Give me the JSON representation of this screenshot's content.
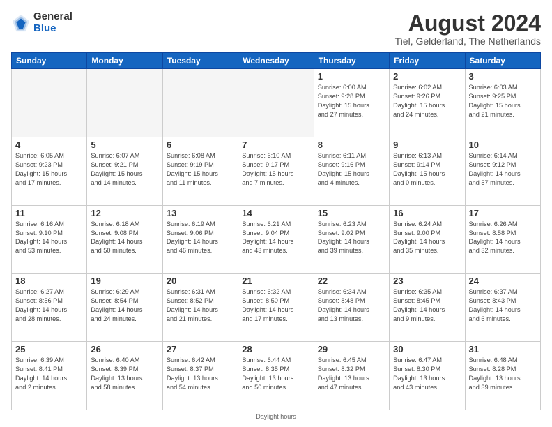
{
  "header": {
    "logo_general": "General",
    "logo_blue": "Blue",
    "main_title": "August 2024",
    "subtitle": "Tiel, Gelderland, The Netherlands"
  },
  "days_of_week": [
    "Sunday",
    "Monday",
    "Tuesday",
    "Wednesday",
    "Thursday",
    "Friday",
    "Saturday"
  ],
  "weeks": [
    [
      {
        "day": "",
        "info": "",
        "empty": true
      },
      {
        "day": "",
        "info": "",
        "empty": true
      },
      {
        "day": "",
        "info": "",
        "empty": true
      },
      {
        "day": "",
        "info": "",
        "empty": true
      },
      {
        "day": "1",
        "info": "Sunrise: 6:00 AM\nSunset: 9:28 PM\nDaylight: 15 hours\nand 27 minutes."
      },
      {
        "day": "2",
        "info": "Sunrise: 6:02 AM\nSunset: 9:26 PM\nDaylight: 15 hours\nand 24 minutes."
      },
      {
        "day": "3",
        "info": "Sunrise: 6:03 AM\nSunset: 9:25 PM\nDaylight: 15 hours\nand 21 minutes."
      }
    ],
    [
      {
        "day": "4",
        "info": "Sunrise: 6:05 AM\nSunset: 9:23 PM\nDaylight: 15 hours\nand 17 minutes."
      },
      {
        "day": "5",
        "info": "Sunrise: 6:07 AM\nSunset: 9:21 PM\nDaylight: 15 hours\nand 14 minutes."
      },
      {
        "day": "6",
        "info": "Sunrise: 6:08 AM\nSunset: 9:19 PM\nDaylight: 15 hours\nand 11 minutes."
      },
      {
        "day": "7",
        "info": "Sunrise: 6:10 AM\nSunset: 9:17 PM\nDaylight: 15 hours\nand 7 minutes."
      },
      {
        "day": "8",
        "info": "Sunrise: 6:11 AM\nSunset: 9:16 PM\nDaylight: 15 hours\nand 4 minutes."
      },
      {
        "day": "9",
        "info": "Sunrise: 6:13 AM\nSunset: 9:14 PM\nDaylight: 15 hours\nand 0 minutes."
      },
      {
        "day": "10",
        "info": "Sunrise: 6:14 AM\nSunset: 9:12 PM\nDaylight: 14 hours\nand 57 minutes."
      }
    ],
    [
      {
        "day": "11",
        "info": "Sunrise: 6:16 AM\nSunset: 9:10 PM\nDaylight: 14 hours\nand 53 minutes."
      },
      {
        "day": "12",
        "info": "Sunrise: 6:18 AM\nSunset: 9:08 PM\nDaylight: 14 hours\nand 50 minutes."
      },
      {
        "day": "13",
        "info": "Sunrise: 6:19 AM\nSunset: 9:06 PM\nDaylight: 14 hours\nand 46 minutes."
      },
      {
        "day": "14",
        "info": "Sunrise: 6:21 AM\nSunset: 9:04 PM\nDaylight: 14 hours\nand 43 minutes."
      },
      {
        "day": "15",
        "info": "Sunrise: 6:23 AM\nSunset: 9:02 PM\nDaylight: 14 hours\nand 39 minutes."
      },
      {
        "day": "16",
        "info": "Sunrise: 6:24 AM\nSunset: 9:00 PM\nDaylight: 14 hours\nand 35 minutes."
      },
      {
        "day": "17",
        "info": "Sunrise: 6:26 AM\nSunset: 8:58 PM\nDaylight: 14 hours\nand 32 minutes."
      }
    ],
    [
      {
        "day": "18",
        "info": "Sunrise: 6:27 AM\nSunset: 8:56 PM\nDaylight: 14 hours\nand 28 minutes."
      },
      {
        "day": "19",
        "info": "Sunrise: 6:29 AM\nSunset: 8:54 PM\nDaylight: 14 hours\nand 24 minutes."
      },
      {
        "day": "20",
        "info": "Sunrise: 6:31 AM\nSunset: 8:52 PM\nDaylight: 14 hours\nand 21 minutes."
      },
      {
        "day": "21",
        "info": "Sunrise: 6:32 AM\nSunset: 8:50 PM\nDaylight: 14 hours\nand 17 minutes."
      },
      {
        "day": "22",
        "info": "Sunrise: 6:34 AM\nSunset: 8:48 PM\nDaylight: 14 hours\nand 13 minutes."
      },
      {
        "day": "23",
        "info": "Sunrise: 6:35 AM\nSunset: 8:45 PM\nDaylight: 14 hours\nand 9 minutes."
      },
      {
        "day": "24",
        "info": "Sunrise: 6:37 AM\nSunset: 8:43 PM\nDaylight: 14 hours\nand 6 minutes."
      }
    ],
    [
      {
        "day": "25",
        "info": "Sunrise: 6:39 AM\nSunset: 8:41 PM\nDaylight: 14 hours\nand 2 minutes."
      },
      {
        "day": "26",
        "info": "Sunrise: 6:40 AM\nSunset: 8:39 PM\nDaylight: 13 hours\nand 58 minutes."
      },
      {
        "day": "27",
        "info": "Sunrise: 6:42 AM\nSunset: 8:37 PM\nDaylight: 13 hours\nand 54 minutes."
      },
      {
        "day": "28",
        "info": "Sunrise: 6:44 AM\nSunset: 8:35 PM\nDaylight: 13 hours\nand 50 minutes."
      },
      {
        "day": "29",
        "info": "Sunrise: 6:45 AM\nSunset: 8:32 PM\nDaylight: 13 hours\nand 47 minutes."
      },
      {
        "day": "30",
        "info": "Sunrise: 6:47 AM\nSunset: 8:30 PM\nDaylight: 13 hours\nand 43 minutes."
      },
      {
        "day": "31",
        "info": "Sunrise: 6:48 AM\nSunset: 8:28 PM\nDaylight: 13 hours\nand 39 minutes."
      }
    ]
  ],
  "footer_text": "Daylight hours"
}
